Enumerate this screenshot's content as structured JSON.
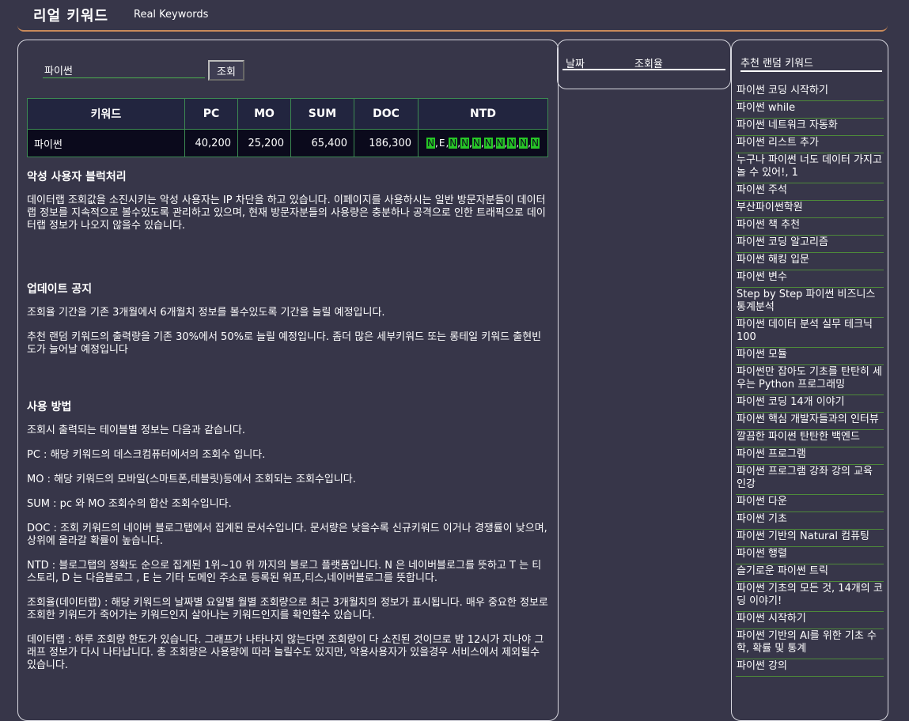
{
  "header": {
    "title": "리얼 키워드",
    "subtitle": "Real Keywords"
  },
  "search": {
    "value": "파이썬",
    "button_label": "조회"
  },
  "table": {
    "headers": [
      "키워드",
      "PC",
      "MO",
      "SUM",
      "DOC",
      "NTD"
    ],
    "row": {
      "keyword": "파이썬",
      "pc": "40,200",
      "mo": "25,200",
      "sum": "65,400",
      "doc": "186,300",
      "ntd": [
        "N",
        "E",
        "N",
        "N",
        "N",
        "N",
        "N",
        "N",
        "N",
        "N"
      ]
    }
  },
  "notices": {
    "block": {
      "title": "악성 사용자 블럭처리",
      "text": "데이터랩 조회값을 소진시키는 악성 사용자는 IP 차단을 하고 있습니다. 이페이지를 사용하시는 일반 방문자분들이 데이터랩 정보를 지속적으로 볼수있도록 관리하고 있으며, 현재 방문자분들의 사용량은 충분하나 공격으로 인한 트래픽으로 데이터랩 정보가 나오지 않을수 있습니다."
    },
    "update": {
      "title": "업데이트 공지",
      "items": [
        "조회율 기간을 기존 3개월에서 6개월치 정보를 볼수있도록 기간을 늘릴 예정입니다.",
        "추천 랜덤 키워드의 출력량을 기존 30%에서 50%로 늘릴 예정입니다. 좀더 많은 세부키워드 또는 롱테일 키워드 출현빈도가 늘어날 예정입니다"
      ]
    },
    "usage": {
      "title": "사용 방법",
      "items": [
        "조회시 출력되는 테이블별 정보는 다음과 같습니다.",
        "PC : 해당 키워드의 데스크컴퓨터에서의 조회수 입니다.",
        "MO : 해당 키워드의 모바일(스마트폰,테블릿)등에서 조회되는 조회수입니다.",
        "SUM : pc 와 MO 조회수의 합산 조회수입니다.",
        "DOC : 조회 키워드의 네이버 블로그탭에서 집계된 문서수입니다. 문서량은 낮을수록 신규키워드 이거나 경쟁률이 낮으며, 상위에 올라갈 확률이 높습니다.",
        "NTD : 블로그탭의 정확도 순으로 집계된 1위~10 위 까지의 블로그 플랫폼입니다. N 은 네이버블로그를 뜻하고 T 는 티스토리, D 는 다음블로그 , E 는 기타 도메인 주소로 등록된 워프,티스,네이버블로그를 뜻합니다.",
        "조회율(데이터랩) : 해당 키워드의 날짜별 요일별 월별 조회량으로 최근 3개월치의 정보가 표시됩니다. 매우 중요한 정보로 조회한 키워드가 죽어가는 키워드인지 살아나는 키워드인지를 확인할수 있습니다.",
        "데이터랩 : 하루 조회량 한도가 있습니다. 그래프가 나타나지 않는다면 조회량이 다 소진된 것이므로 밤 12시가 지나야 그래프 정보가 다시 나타납니다. 총 조회량은 사용량에 따라 늘릴수도 있지만, 악용사용자가 있을경우 서비스에서 제외될수 있습니다."
      ]
    }
  },
  "date_panel": {
    "col_date": "날짜",
    "col_views": "조회율"
  },
  "sidebar": {
    "title": "추천 랜덤 키워드",
    "items": [
      "파이썬 코딩 시작하기",
      "파이썬 while",
      "파이썬 네트워크 자동화",
      "파이썬 리스트 추가",
      "누구나 파이썬 너도 데이터 가지고 놀 수 있어!, 1",
      "파이썬 주석",
      "부산파이썬학원",
      "파이썬 책 추천",
      "파이썬 코딩 알고리즘",
      "파이썬 해킹 입문",
      "파이썬 변수",
      "Step by Step 파이썬 비즈니스 통계분석",
      "파이썬 데이터 분석 실무 테크닉 100",
      "파이썬 모듈",
      "파이썬만 잡아도 기초를 탄탄히 세우는 Python 프로그래밍",
      "파이썬 코딩 14개 이야기",
      "파이썬 핵심 개발자들과의 인터뷰",
      "깔끔한 파이썬 탄탄한 백엔드",
      "파이썬 프로그램",
      "파이썬 프로그램 강좌 강의 교육 인강",
      "파이썬 다운",
      "파이썬 기초",
      "파이썬 기반의 Natural 컴퓨팅",
      "파이썬 행렬",
      "슬기로운 파이썬 트릭",
      "파이썬 기초의 모든 것, 14개의 코딩 이야기!",
      "파이썬 시작하기",
      "파이썬 기반의 AI를 위한 기초 수학, 확률 및 통계",
      "파이썬 강의"
    ]
  }
}
